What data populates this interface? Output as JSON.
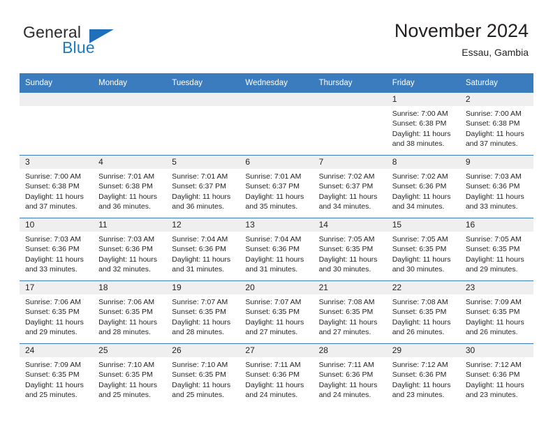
{
  "brand": {
    "name_part1": "General",
    "name_part2": "Blue",
    "logo_icon": "triangle-flag-mark"
  },
  "header": {
    "title": "November 2024",
    "subtitle": "Essau, Gambia"
  },
  "calendar": {
    "weekday_headers": [
      "Sunday",
      "Monday",
      "Tuesday",
      "Wednesday",
      "Thursday",
      "Friday",
      "Saturday"
    ],
    "colors": {
      "header_blue": "#3a7cbe",
      "daynum_band": "#efefef",
      "brand_blue": "#1f7ac4",
      "text": "#231f20"
    },
    "weeks": [
      [
        {
          "day": "",
          "empty": true
        },
        {
          "day": "",
          "empty": true
        },
        {
          "day": "",
          "empty": true
        },
        {
          "day": "",
          "empty": true
        },
        {
          "day": "",
          "empty": true
        },
        {
          "day": "1",
          "sunrise": "Sunrise: 7:00 AM",
          "sunset": "Sunset: 6:38 PM",
          "daylight_line1": "Daylight: 11 hours",
          "daylight_line2": "and 38 minutes."
        },
        {
          "day": "2",
          "sunrise": "Sunrise: 7:00 AM",
          "sunset": "Sunset: 6:38 PM",
          "daylight_line1": "Daylight: 11 hours",
          "daylight_line2": "and 37 minutes."
        }
      ],
      [
        {
          "day": "3",
          "sunrise": "Sunrise: 7:00 AM",
          "sunset": "Sunset: 6:38 PM",
          "daylight_line1": "Daylight: 11 hours",
          "daylight_line2": "and 37 minutes."
        },
        {
          "day": "4",
          "sunrise": "Sunrise: 7:01 AM",
          "sunset": "Sunset: 6:38 PM",
          "daylight_line1": "Daylight: 11 hours",
          "daylight_line2": "and 36 minutes."
        },
        {
          "day": "5",
          "sunrise": "Sunrise: 7:01 AM",
          "sunset": "Sunset: 6:37 PM",
          "daylight_line1": "Daylight: 11 hours",
          "daylight_line2": "and 36 minutes."
        },
        {
          "day": "6",
          "sunrise": "Sunrise: 7:01 AM",
          "sunset": "Sunset: 6:37 PM",
          "daylight_line1": "Daylight: 11 hours",
          "daylight_line2": "and 35 minutes."
        },
        {
          "day": "7",
          "sunrise": "Sunrise: 7:02 AM",
          "sunset": "Sunset: 6:37 PM",
          "daylight_line1": "Daylight: 11 hours",
          "daylight_line2": "and 34 minutes."
        },
        {
          "day": "8",
          "sunrise": "Sunrise: 7:02 AM",
          "sunset": "Sunset: 6:36 PM",
          "daylight_line1": "Daylight: 11 hours",
          "daylight_line2": "and 34 minutes."
        },
        {
          "day": "9",
          "sunrise": "Sunrise: 7:03 AM",
          "sunset": "Sunset: 6:36 PM",
          "daylight_line1": "Daylight: 11 hours",
          "daylight_line2": "and 33 minutes."
        }
      ],
      [
        {
          "day": "10",
          "sunrise": "Sunrise: 7:03 AM",
          "sunset": "Sunset: 6:36 PM",
          "daylight_line1": "Daylight: 11 hours",
          "daylight_line2": "and 33 minutes."
        },
        {
          "day": "11",
          "sunrise": "Sunrise: 7:03 AM",
          "sunset": "Sunset: 6:36 PM",
          "daylight_line1": "Daylight: 11 hours",
          "daylight_line2": "and 32 minutes."
        },
        {
          "day": "12",
          "sunrise": "Sunrise: 7:04 AM",
          "sunset": "Sunset: 6:36 PM",
          "daylight_line1": "Daylight: 11 hours",
          "daylight_line2": "and 31 minutes."
        },
        {
          "day": "13",
          "sunrise": "Sunrise: 7:04 AM",
          "sunset": "Sunset: 6:36 PM",
          "daylight_line1": "Daylight: 11 hours",
          "daylight_line2": "and 31 minutes."
        },
        {
          "day": "14",
          "sunrise": "Sunrise: 7:05 AM",
          "sunset": "Sunset: 6:35 PM",
          "daylight_line1": "Daylight: 11 hours",
          "daylight_line2": "and 30 minutes."
        },
        {
          "day": "15",
          "sunrise": "Sunrise: 7:05 AM",
          "sunset": "Sunset: 6:35 PM",
          "daylight_line1": "Daylight: 11 hours",
          "daylight_line2": "and 30 minutes."
        },
        {
          "day": "16",
          "sunrise": "Sunrise: 7:05 AM",
          "sunset": "Sunset: 6:35 PM",
          "daylight_line1": "Daylight: 11 hours",
          "daylight_line2": "and 29 minutes."
        }
      ],
      [
        {
          "day": "17",
          "sunrise": "Sunrise: 7:06 AM",
          "sunset": "Sunset: 6:35 PM",
          "daylight_line1": "Daylight: 11 hours",
          "daylight_line2": "and 29 minutes."
        },
        {
          "day": "18",
          "sunrise": "Sunrise: 7:06 AM",
          "sunset": "Sunset: 6:35 PM",
          "daylight_line1": "Daylight: 11 hours",
          "daylight_line2": "and 28 minutes."
        },
        {
          "day": "19",
          "sunrise": "Sunrise: 7:07 AM",
          "sunset": "Sunset: 6:35 PM",
          "daylight_line1": "Daylight: 11 hours",
          "daylight_line2": "and 28 minutes."
        },
        {
          "day": "20",
          "sunrise": "Sunrise: 7:07 AM",
          "sunset": "Sunset: 6:35 PM",
          "daylight_line1": "Daylight: 11 hours",
          "daylight_line2": "and 27 minutes."
        },
        {
          "day": "21",
          "sunrise": "Sunrise: 7:08 AM",
          "sunset": "Sunset: 6:35 PM",
          "daylight_line1": "Daylight: 11 hours",
          "daylight_line2": "and 27 minutes."
        },
        {
          "day": "22",
          "sunrise": "Sunrise: 7:08 AM",
          "sunset": "Sunset: 6:35 PM",
          "daylight_line1": "Daylight: 11 hours",
          "daylight_line2": "and 26 minutes."
        },
        {
          "day": "23",
          "sunrise": "Sunrise: 7:09 AM",
          "sunset": "Sunset: 6:35 PM",
          "daylight_line1": "Daylight: 11 hours",
          "daylight_line2": "and 26 minutes."
        }
      ],
      [
        {
          "day": "24",
          "sunrise": "Sunrise: 7:09 AM",
          "sunset": "Sunset: 6:35 PM",
          "daylight_line1": "Daylight: 11 hours",
          "daylight_line2": "and 25 minutes."
        },
        {
          "day": "25",
          "sunrise": "Sunrise: 7:10 AM",
          "sunset": "Sunset: 6:35 PM",
          "daylight_line1": "Daylight: 11 hours",
          "daylight_line2": "and 25 minutes."
        },
        {
          "day": "26",
          "sunrise": "Sunrise: 7:10 AM",
          "sunset": "Sunset: 6:35 PM",
          "daylight_line1": "Daylight: 11 hours",
          "daylight_line2": "and 25 minutes."
        },
        {
          "day": "27",
          "sunrise": "Sunrise: 7:11 AM",
          "sunset": "Sunset: 6:36 PM",
          "daylight_line1": "Daylight: 11 hours",
          "daylight_line2": "and 24 minutes."
        },
        {
          "day": "28",
          "sunrise": "Sunrise: 7:11 AM",
          "sunset": "Sunset: 6:36 PM",
          "daylight_line1": "Daylight: 11 hours",
          "daylight_line2": "and 24 minutes."
        },
        {
          "day": "29",
          "sunrise": "Sunrise: 7:12 AM",
          "sunset": "Sunset: 6:36 PM",
          "daylight_line1": "Daylight: 11 hours",
          "daylight_line2": "and 23 minutes."
        },
        {
          "day": "30",
          "sunrise": "Sunrise: 7:12 AM",
          "sunset": "Sunset: 6:36 PM",
          "daylight_line1": "Daylight: 11 hours",
          "daylight_line2": "and 23 minutes."
        }
      ]
    ]
  }
}
